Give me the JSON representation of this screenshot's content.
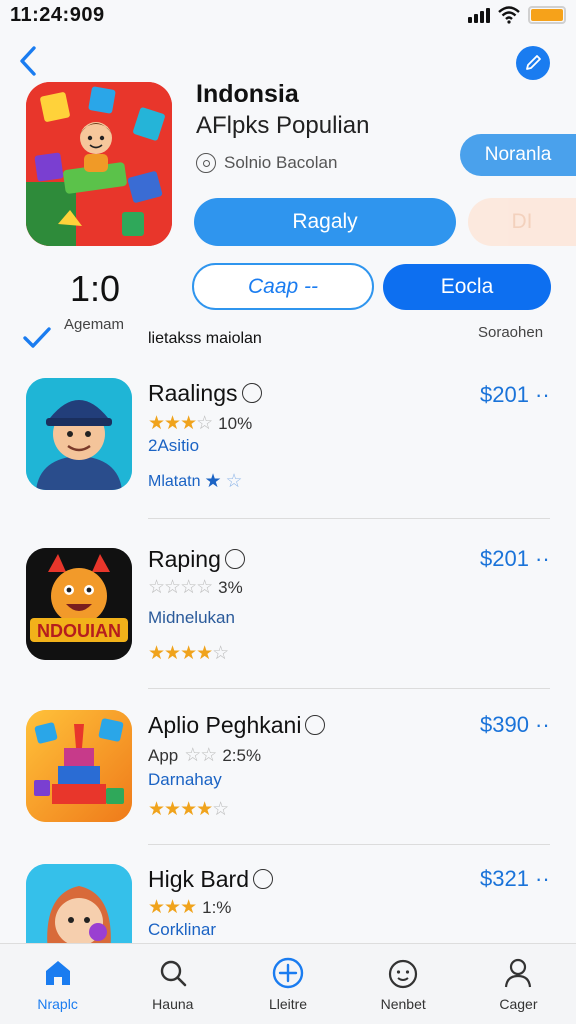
{
  "status": {
    "time": "11:24:909"
  },
  "header": {
    "title": "Indonsia",
    "subtitle": "AFlpks Populian",
    "source": "Solnio Bacolan"
  },
  "buttons": {
    "normal": "Noranla",
    "ragaly": "Ragaly",
    "ghost": "DI",
    "caap": "Caap --",
    "eocla": "Eocla"
  },
  "rating": {
    "value": "1:0",
    "label": "Agemam"
  },
  "section": {
    "title": "lietakss maiolan",
    "right": "Soraohen"
  },
  "apps": [
    {
      "title": "Raalings",
      "price": "$201 ··",
      "stars": 3,
      "rating_text": "10%",
      "developer": "2Asitio",
      "extra_label": "Mlatatn",
      "extra_stars": 1
    },
    {
      "title": "Raping",
      "price": "$201 ··",
      "stars": 0,
      "rating_text": "3%",
      "developer": "Midnelukan",
      "extra_label": "",
      "extra_stars": 4
    },
    {
      "title": "Aplio Peghkani",
      "price": "$390 ··",
      "stars_prefix": "App",
      "stars": 0,
      "rating_text": "2:5%",
      "developer": "Darnahay",
      "extra_label": "",
      "extra_stars": 4
    },
    {
      "title": "Higk Bard",
      "price": "$321 ··",
      "stars": 3,
      "rating_text": "1:%",
      "developer": "Corklinar"
    }
  ],
  "tabs": [
    {
      "label": "Nraplc",
      "icon": "home-icon",
      "active": true
    },
    {
      "label": "Hauna",
      "icon": "search-icon",
      "active": false
    },
    {
      "label": "Lleitre",
      "icon": "add-circle-icon",
      "active": false
    },
    {
      "label": "Nenbet",
      "icon": "face-icon",
      "active": false
    },
    {
      "label": "Cager",
      "icon": "user-icon",
      "active": false
    }
  ],
  "colors": {
    "accent": "#1a7cf0",
    "price": "#1a73d9",
    "star": "#f0a31c",
    "hero_bg": "#e8362b"
  }
}
